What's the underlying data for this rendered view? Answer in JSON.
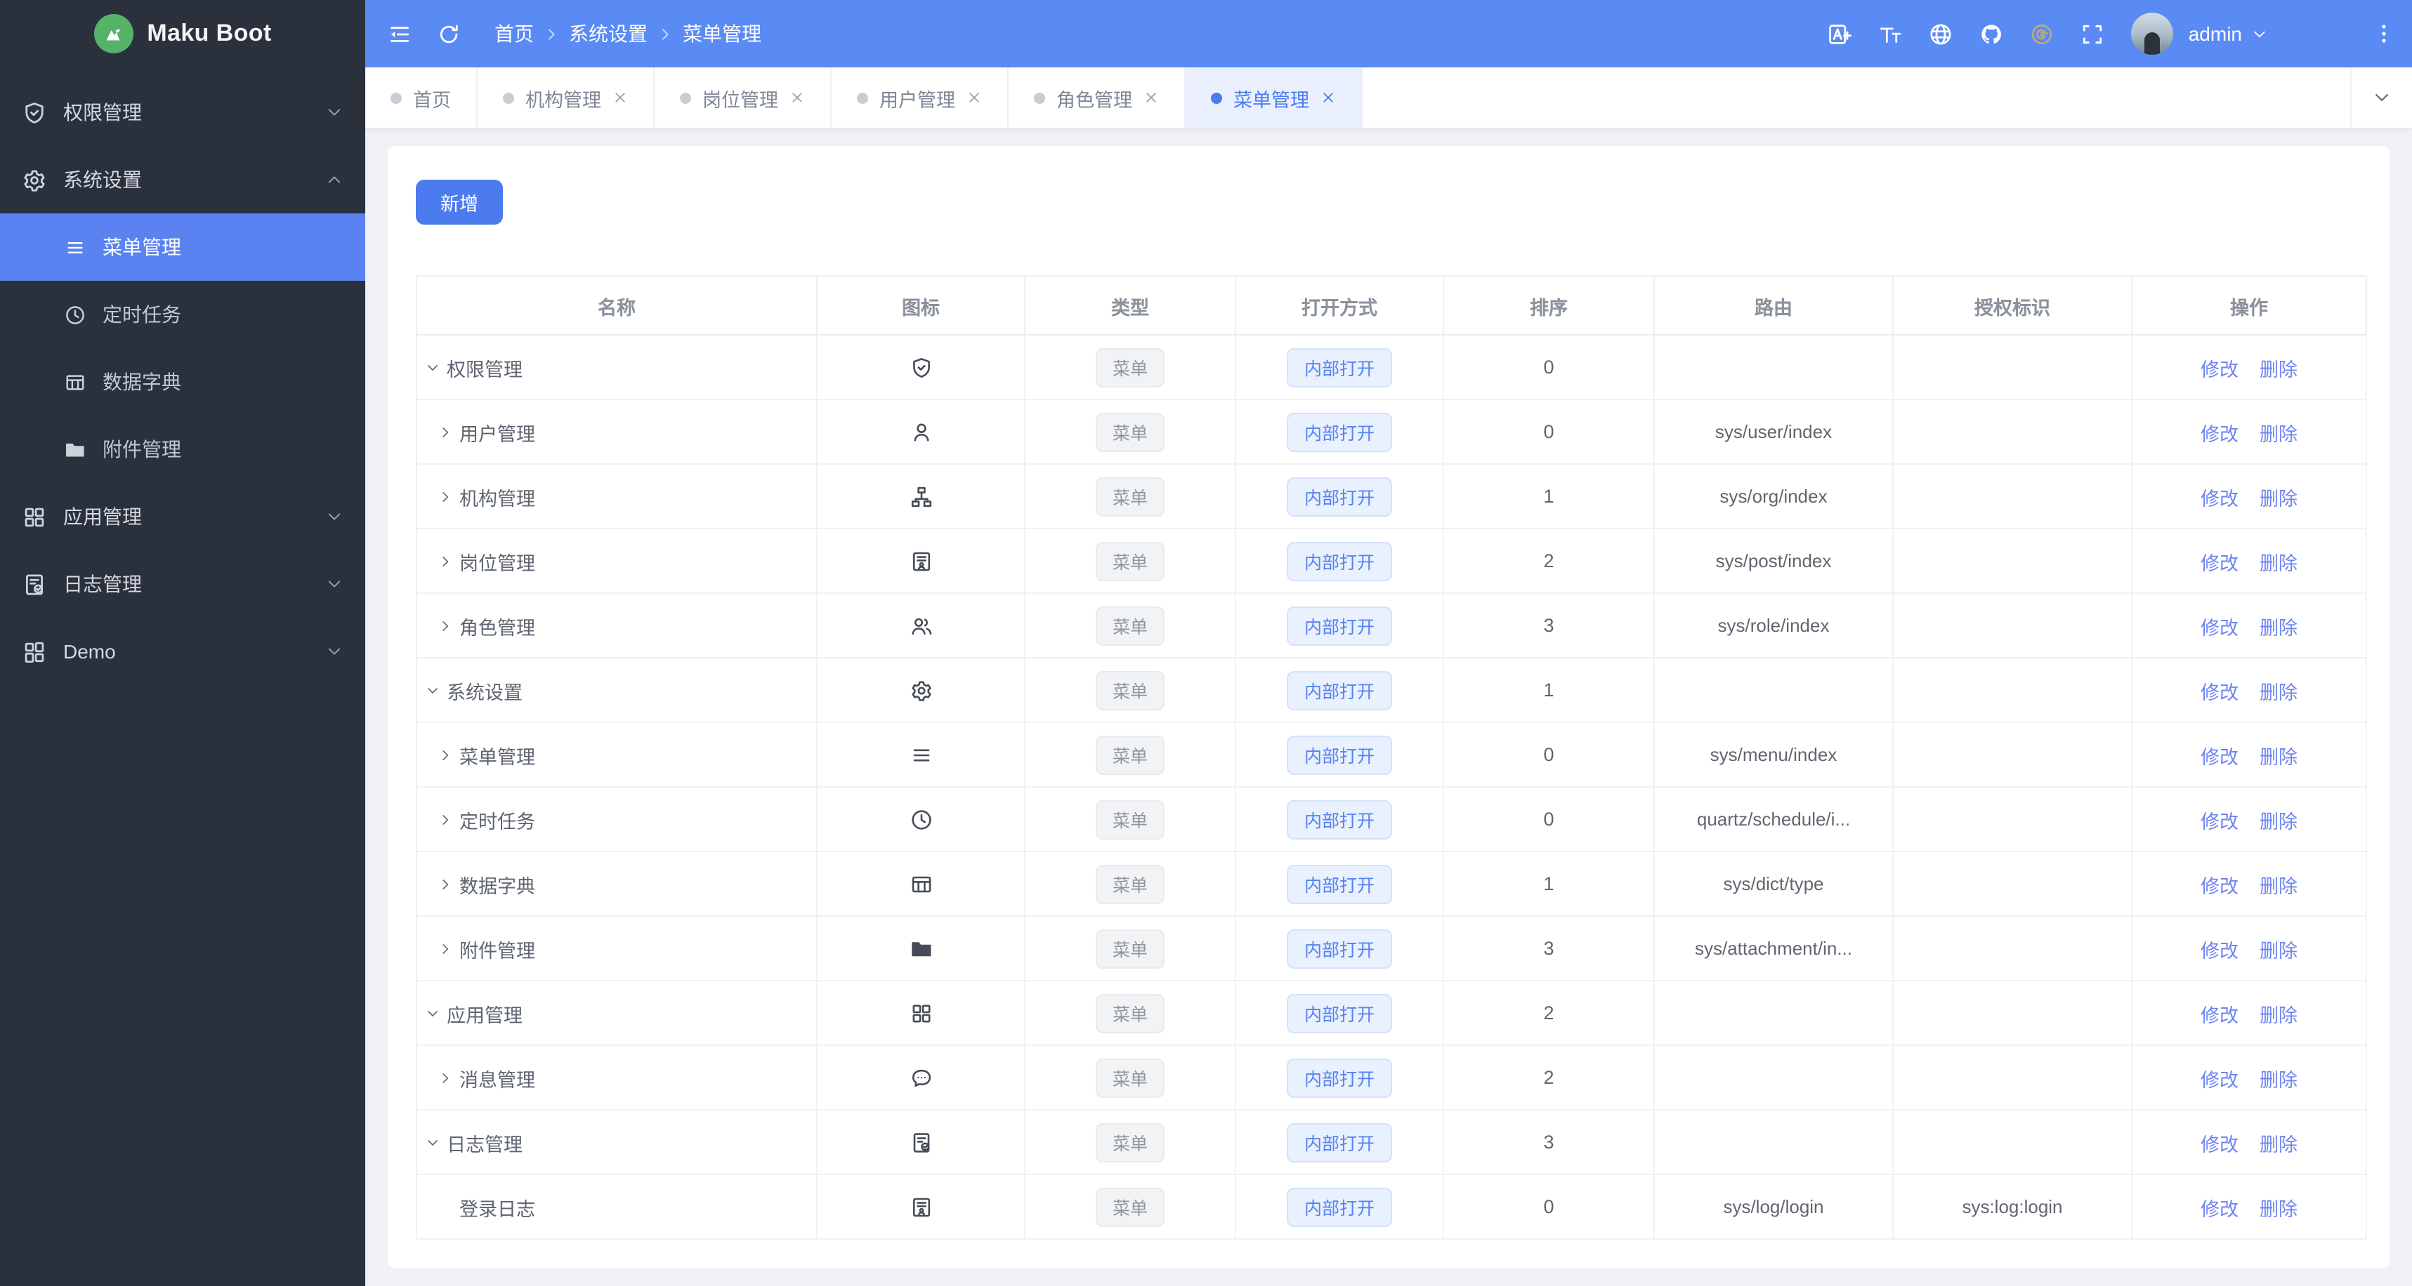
{
  "app": {
    "title": "Maku Boot"
  },
  "colors": {
    "header_blue": "#5a8bf5",
    "sidebar_bg": "#2a313d",
    "active_item_blue": "#5a82f0",
    "accent_blue": "#4b7bf1",
    "button_blue": "#4c7bf0",
    "link_blue": "#6e84f2",
    "tab_active_bg": "#e9effd",
    "open_badge_bg": "#e9f0fe",
    "open_badge_text": "#5583f2",
    "type_badge_bg": "#f1f3f5",
    "type_badge_text": "#8f96a0",
    "logo_green": "#56b169",
    "gitee_gold": "#b9aa80",
    "page_bg": "#eff1f5"
  },
  "header": {
    "breadcrumb": [
      "首页",
      "系统设置",
      "菜单管理"
    ],
    "icons": [
      "translate",
      "font-size",
      "globe",
      "github",
      "gitee",
      "fullscreen"
    ],
    "user": "admin"
  },
  "tabs": {
    "items": [
      {
        "label": "首页",
        "closable": false,
        "active": false
      },
      {
        "label": "机构管理",
        "closable": true,
        "active": false
      },
      {
        "label": "岗位管理",
        "closable": true,
        "active": false
      },
      {
        "label": "用户管理",
        "closable": true,
        "active": false
      },
      {
        "label": "角色管理",
        "closable": true,
        "active": false
      },
      {
        "label": "菜单管理",
        "closable": true,
        "active": true
      }
    ]
  },
  "sidebar": {
    "items": [
      {
        "label": "权限管理",
        "icon": "shield-check",
        "chevron": "down",
        "children": []
      },
      {
        "label": "系统设置",
        "icon": "gear",
        "chevron": "up",
        "children": [
          {
            "label": "菜单管理",
            "icon": "menu-lines",
            "active": true
          },
          {
            "label": "定时任务",
            "icon": "clock"
          },
          {
            "label": "数据字典",
            "icon": "table-grid"
          },
          {
            "label": "附件管理",
            "icon": "folder"
          }
        ]
      },
      {
        "label": "应用管理",
        "icon": "grid",
        "chevron": "down",
        "children": []
      },
      {
        "label": "日志管理",
        "icon": "doc-check",
        "chevron": "down",
        "children": []
      },
      {
        "label": "Demo",
        "icon": "grid-alt",
        "chevron": "down",
        "children": []
      }
    ]
  },
  "toolbar": {
    "add_label": "新增"
  },
  "table": {
    "columns": [
      "名称",
      "图标",
      "类型",
      "打开方式",
      "排序",
      "路由",
      "授权标识",
      "操作"
    ],
    "actions": [
      "修改",
      "删除"
    ],
    "rows": [
      {
        "name": "权限管理",
        "level": 0,
        "expand": "down",
        "icon": "shield-check",
        "type": "菜单",
        "open": "内部打开",
        "sort": "0",
        "route": "",
        "auth": ""
      },
      {
        "name": "用户管理",
        "level": 1,
        "expand": "right",
        "icon": "user",
        "type": "菜单",
        "open": "内部打开",
        "sort": "0",
        "route": "sys/user/index",
        "auth": ""
      },
      {
        "name": "机构管理",
        "level": 1,
        "expand": "right",
        "icon": "org-tree",
        "type": "菜单",
        "open": "内部打开",
        "sort": "1",
        "route": "sys/org/index",
        "auth": ""
      },
      {
        "name": "岗位管理",
        "level": 1,
        "expand": "right",
        "icon": "id-card",
        "type": "菜单",
        "open": "内部打开",
        "sort": "2",
        "route": "sys/post/index",
        "auth": ""
      },
      {
        "name": "角色管理",
        "level": 1,
        "expand": "right",
        "icon": "users",
        "type": "菜单",
        "open": "内部打开",
        "sort": "3",
        "route": "sys/role/index",
        "auth": ""
      },
      {
        "name": "系统设置",
        "level": 0,
        "expand": "down",
        "icon": "gear",
        "type": "菜单",
        "open": "内部打开",
        "sort": "1",
        "route": "",
        "auth": ""
      },
      {
        "name": "菜单管理",
        "level": 1,
        "expand": "right",
        "icon": "menu-lines",
        "type": "菜单",
        "open": "内部打开",
        "sort": "0",
        "route": "sys/menu/index",
        "auth": ""
      },
      {
        "name": "定时任务",
        "level": 1,
        "expand": "right",
        "icon": "clock",
        "type": "菜单",
        "open": "内部打开",
        "sort": "0",
        "route": "quartz/schedule/i...",
        "auth": ""
      },
      {
        "name": "数据字典",
        "level": 1,
        "expand": "right",
        "icon": "table-grid",
        "type": "菜单",
        "open": "内部打开",
        "sort": "1",
        "route": "sys/dict/type",
        "auth": ""
      },
      {
        "name": "附件管理",
        "level": 1,
        "expand": "right",
        "icon": "folder",
        "type": "菜单",
        "open": "内部打开",
        "sort": "3",
        "route": "sys/attachment/in...",
        "auth": ""
      },
      {
        "name": "应用管理",
        "level": 0,
        "expand": "down",
        "icon": "grid",
        "type": "菜单",
        "open": "内部打开",
        "sort": "2",
        "route": "",
        "auth": ""
      },
      {
        "name": "消息管理",
        "level": 1,
        "expand": "right",
        "icon": "chat-dots",
        "type": "菜单",
        "open": "内部打开",
        "sort": "2",
        "route": "",
        "auth": ""
      },
      {
        "name": "日志管理",
        "level": 0,
        "expand": "down",
        "icon": "doc-check",
        "type": "菜单",
        "open": "内部打开",
        "sort": "3",
        "route": "",
        "auth": ""
      },
      {
        "name": "登录日志",
        "level": 1,
        "expand": "none",
        "icon": "id-card",
        "type": "菜单",
        "open": "内部打开",
        "sort": "0",
        "route": "sys/log/login",
        "auth": "sys:log:login"
      }
    ]
  }
}
